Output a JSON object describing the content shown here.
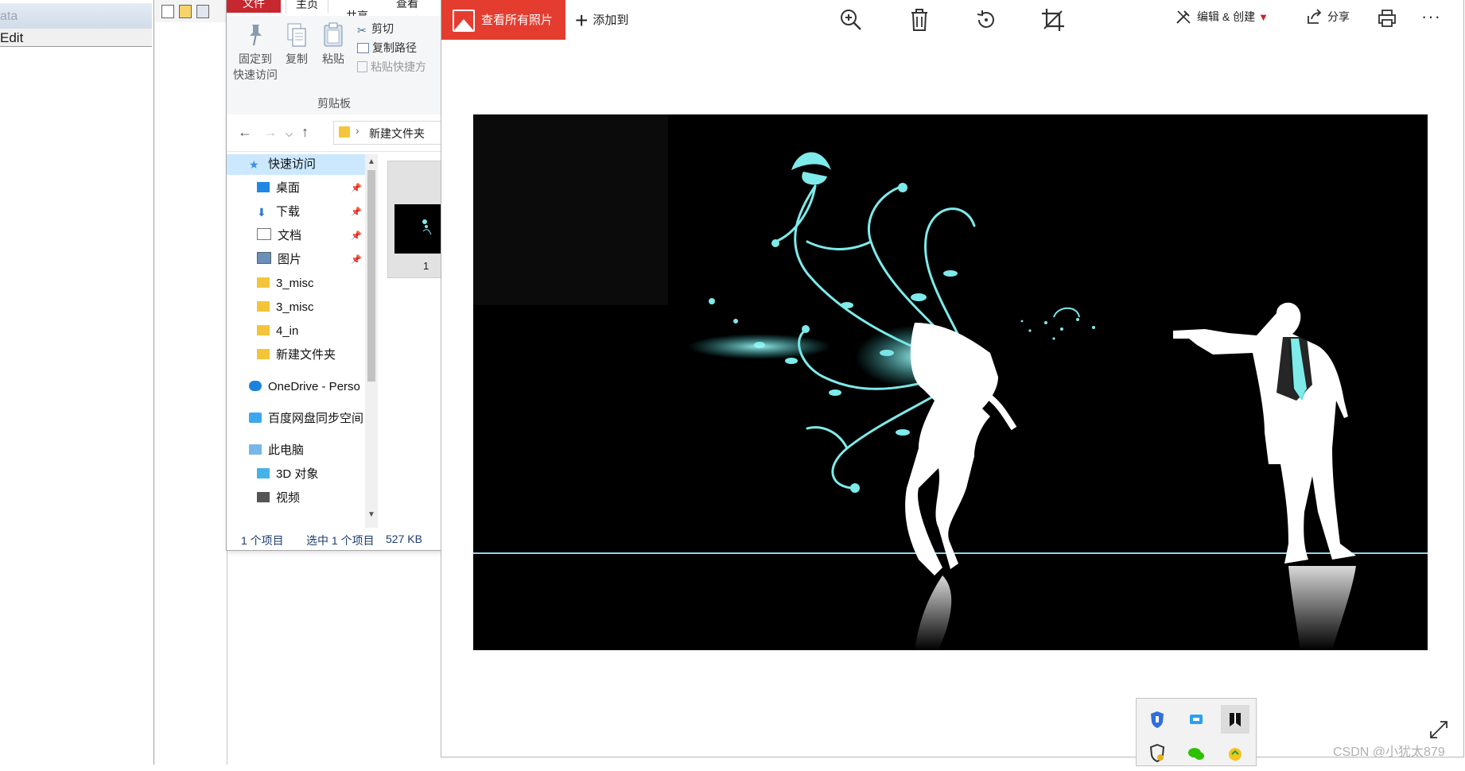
{
  "left_window": {
    "title_fragment": "ata",
    "menu_fragment": "Edit"
  },
  "explorer": {
    "tabs": [
      "文件",
      "主页",
      "共享",
      "查看"
    ],
    "ribbon": {
      "pin_label_line1": "固定到",
      "pin_label_line2": "快速访问",
      "copy_label": "复制",
      "paste_label": "粘贴",
      "cut_label": "剪切",
      "copy_path_label": "复制路径",
      "paste_shortcut_label": "粘贴快捷方",
      "group_caption": "剪贴板"
    },
    "address": {
      "crumb": "新建文件夹"
    },
    "nav_items": [
      {
        "label": "快速访问",
        "icon": "star-icon",
        "pinned": false
      },
      {
        "label": "桌面",
        "icon": "desktop-icon",
        "pinned": true
      },
      {
        "label": "下载",
        "icon": "download-icon",
        "pinned": true
      },
      {
        "label": "文档",
        "icon": "document-icon",
        "pinned": true
      },
      {
        "label": "图片",
        "icon": "picture-icon",
        "pinned": true
      },
      {
        "label": "3_misc",
        "icon": "folder-icon",
        "pinned": false
      },
      {
        "label": "3_misc",
        "icon": "folder-icon",
        "pinned": false
      },
      {
        "label": "4_in",
        "icon": "folder-icon",
        "pinned": false
      },
      {
        "label": "新建文件夹",
        "icon": "folder-icon",
        "pinned": false
      },
      {
        "label": "OneDrive - Perso",
        "icon": "cloud-icon",
        "pinned": false
      },
      {
        "label": "百度网盘同步空间",
        "icon": "baidu-sync-icon",
        "pinned": false
      },
      {
        "label": "此电脑",
        "icon": "computer-icon",
        "pinned": false
      },
      {
        "label": "3D 对象",
        "icon": "cube-icon",
        "pinned": false
      },
      {
        "label": "视频",
        "icon": "video-icon",
        "pinned": false
      }
    ],
    "thumbnail_label": "1",
    "status": {
      "count": "1 个项目",
      "selected": "选中 1 个项目",
      "size": "527 KB"
    }
  },
  "photos": {
    "see_all_label": "查看所有照片",
    "add_to_label": "添加到",
    "edit_create_label": "编辑 & 创建",
    "share_label": "分享"
  },
  "watermark": "CSDN @小犹太879",
  "colors": {
    "accent_red": "#e43d30",
    "file_tab_red": "#c7272e",
    "cyan_art": "#7eeaea"
  }
}
